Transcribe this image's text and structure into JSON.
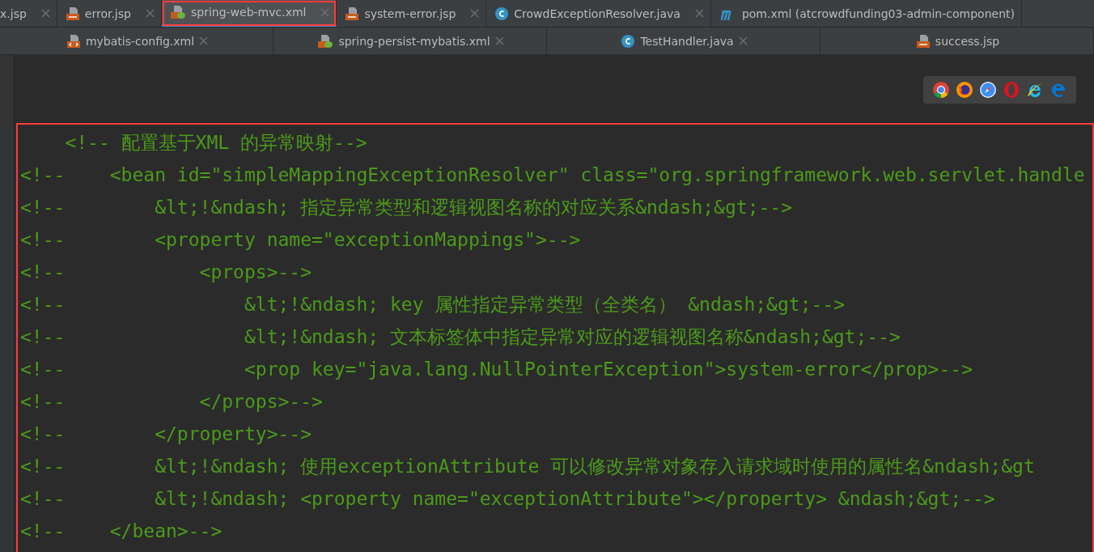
{
  "tab_rows": [
    [
      {
        "label": "x.jsp",
        "kind": "none",
        "selected": false,
        "close_button": true
      },
      {
        "label": "error.jsp",
        "kind": "jsp",
        "selected": false,
        "close_button": true
      },
      {
        "label": "spring-web-mvc.xml",
        "kind": "spring-xml",
        "selected": true,
        "close_button": true
      },
      {
        "label": "system-error.jsp",
        "kind": "jsp",
        "selected": false,
        "close_button": true
      },
      {
        "label": "CrowdExceptionResolver.java",
        "kind": "java",
        "selected": false,
        "close_button": true
      },
      {
        "label": "pom.xml (atcrowdfunding03-admin-component)",
        "kind": "maven",
        "selected": false,
        "close_button": false
      }
    ],
    [
      {
        "label": "mybatis-config.xml",
        "kind": "xml",
        "selected": false,
        "close_button": true
      },
      {
        "label": "spring-persist-mybatis.xml",
        "kind": "spring-xml",
        "selected": false,
        "close_button": true
      },
      {
        "label": "TestHandler.java",
        "kind": "java",
        "selected": false,
        "close_button": true
      },
      {
        "label": "success.jsp",
        "kind": "jsp",
        "selected": false,
        "close_button": false
      }
    ]
  ],
  "browser_bar": [
    {
      "kind": "chrome"
    },
    {
      "kind": "firefox"
    },
    {
      "kind": "safari"
    },
    {
      "kind": "opera"
    },
    {
      "kind": "ie"
    },
    {
      "kind": "edge"
    }
  ],
  "code_lines": [
    "    <!-- 配置基于XML 的异常映射-->",
    "<!--    <bean id=\"simpleMappingExceptionResolver\" class=\"org.springframework.web.servlet.handle",
    "<!--        &lt;!&ndash; 指定异常类型和逻辑视图名称的对应关系&ndash;&gt;-->",
    "<!--        <property name=\"exceptionMappings\">-->",
    "<!--            <props>-->",
    "<!--                &lt;!&ndash; key 属性指定异常类型（全类名） &ndash;&gt;-->",
    "<!--                &lt;!&ndash; 文本标签体中指定异常对应的逻辑视图名称&ndash;&gt;-->",
    "<!--                <prop key=\"java.lang.NullPointerException\">system-error</prop>-->",
    "<!--            </props>-->",
    "<!--        </property>-->",
    "<!--        &lt;!&ndash; 使用exceptionAttribute 可以修改异常对象存入请求域时使用的属性名&ndash;&gt",
    "<!--        &lt;!&ndash; <property name=\"exceptionAttribute\"></property> &ndash;&gt;-->",
    "<!--    </bean>-->"
  ]
}
